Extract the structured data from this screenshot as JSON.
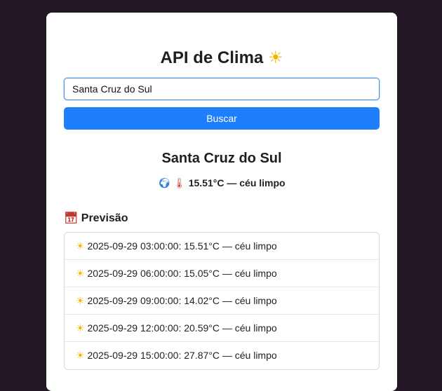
{
  "header": {
    "title": "API de Clima",
    "title_icon": "sun-icon"
  },
  "search": {
    "value": "Santa Cruz do Sul",
    "button_label": "Buscar"
  },
  "current": {
    "city": "Santa Cruz do Sul",
    "temperature": "15.51°C",
    "separator": "—",
    "description": "céu limpo"
  },
  "forecast": {
    "heading": "Previsão",
    "items": [
      {
        "text": "2025-09-29 03:00:00: 15.51°C — céu limpo"
      },
      {
        "text": "2025-09-29 06:00:00: 15.05°C — céu limpo"
      },
      {
        "text": "2025-09-29 09:00:00: 14.02°C — céu limpo"
      },
      {
        "text": "2025-09-29 12:00:00: 20.59°C — céu limpo"
      },
      {
        "text": "2025-09-29 15:00:00: 27.87°C — céu limpo"
      }
    ]
  },
  "colors": {
    "background": "#241726",
    "accent": "#1f7efb"
  }
}
